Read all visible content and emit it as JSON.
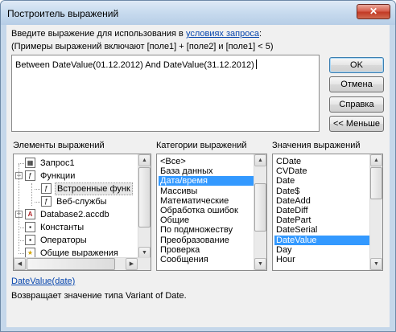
{
  "window": {
    "title": "Построитель выражений",
    "close_label": "✕"
  },
  "instructions": {
    "line1_prefix": "Введите выражение для использования в ",
    "line1_link": "условиях запроса",
    "line1_suffix": ":",
    "line2": "(Примеры выражений включают [поле1] + [поле2] и [поле1] < 5)"
  },
  "expression": {
    "value": "Between DateValue(01.12.2012) And DateValue(31.12.2012)"
  },
  "buttons": {
    "ok": "OK",
    "cancel": "Отмена",
    "help": "Справка",
    "less": "<< Меньше"
  },
  "panes": {
    "elements_label": "Элементы выражений",
    "categories_label": "Категории выражений",
    "values_label": "Значения выражений"
  },
  "elements_tree": [
    {
      "label": "Запрос1",
      "icon": "query-icon"
    },
    {
      "label": "Функции",
      "icon": "functions-icon",
      "toggle": "−"
    },
    {
      "label": "Встроенные функ",
      "icon": "function-fx-icon",
      "selected": true
    },
    {
      "label": "Веб-службы",
      "icon": "function-fx-icon"
    },
    {
      "label": "Database2.accdb",
      "icon": "database-icon",
      "toggle": "+"
    },
    {
      "label": "Константы",
      "icon": "constants-icon"
    },
    {
      "label": "Операторы",
      "icon": "operators-icon"
    },
    {
      "label": "Общие выражения",
      "icon": "common-expressions-icon"
    }
  ],
  "categories": [
    {
      "label": "<Все>"
    },
    {
      "label": "База данных"
    },
    {
      "label": "Дата/время",
      "selected": true
    },
    {
      "label": "Массивы"
    },
    {
      "label": "Математические"
    },
    {
      "label": "Обработка ошибок"
    },
    {
      "label": "Общие"
    },
    {
      "label": "По подмножеству"
    },
    {
      "label": "Преобразование"
    },
    {
      "label": "Проверка"
    },
    {
      "label": "Сообщения"
    }
  ],
  "values": [
    {
      "label": "CDate"
    },
    {
      "label": "CVDate"
    },
    {
      "label": "Date"
    },
    {
      "label": "Date$"
    },
    {
      "label": "DateAdd"
    },
    {
      "label": "DateDiff"
    },
    {
      "label": "DatePart"
    },
    {
      "label": "DateSerial"
    },
    {
      "label": "DateValue",
      "selected": true
    },
    {
      "label": "Day"
    },
    {
      "label": "Hour"
    }
  ],
  "footer": {
    "function_link": "DateValue(date)",
    "description": "Возвращает значение типа Variant of Date."
  },
  "colors": {
    "selection": "#3399ff",
    "link": "#0645ad"
  }
}
